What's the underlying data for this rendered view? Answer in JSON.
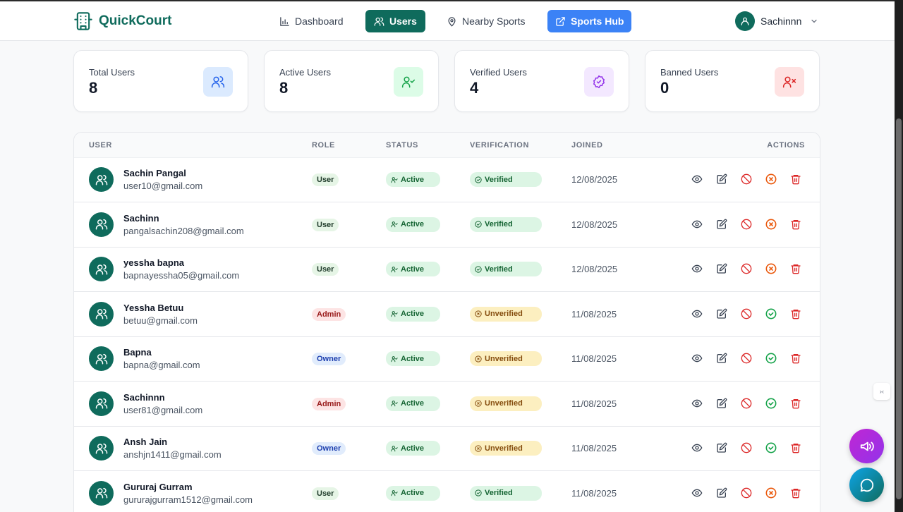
{
  "brand": {
    "name": "QuickCourt"
  },
  "nav": {
    "dashboard": "Dashboard",
    "users": "Users",
    "nearby": "Nearby Sports",
    "hub": "Sports Hub"
  },
  "profile": {
    "name": "Sachinnn"
  },
  "stats": [
    {
      "label": "Total Users",
      "value": "8",
      "icon": "users-icon",
      "bg": "#dbeafe",
      "fg": "#2563eb"
    },
    {
      "label": "Active Users",
      "value": "8",
      "icon": "user-check-icon",
      "bg": "#dcfce7",
      "fg": "#16a34a"
    },
    {
      "label": "Verified Users",
      "value": "4",
      "icon": "badge-check-icon",
      "bg": "#f3e8ff",
      "fg": "#9333ea"
    },
    {
      "label": "Banned Users",
      "value": "0",
      "icon": "user-x-icon",
      "bg": "#fee2e2",
      "fg": "#dc2626"
    }
  ],
  "table": {
    "headers": {
      "user": "USER",
      "role": "ROLE",
      "status": "STATUS",
      "verification": "VERIFICATION",
      "joined": "JOINED",
      "actions": "ACTIONS"
    },
    "rows": [
      {
        "name": "Sachin Pangal",
        "email": "user10@gmail.com",
        "role": "User",
        "status": "Active",
        "verification": "Verified",
        "joined": "12/08/2025"
      },
      {
        "name": "Sachinn",
        "email": "pangalsachin208@gmail.com",
        "role": "User",
        "status": "Active",
        "verification": "Verified",
        "joined": "12/08/2025"
      },
      {
        "name": "yessha bapna",
        "email": "bapnayessha05@gmail.com",
        "role": "User",
        "status": "Active",
        "verification": "Verified",
        "joined": "12/08/2025"
      },
      {
        "name": "Yessha Betuu",
        "email": "betuu@gmail.com",
        "role": "Admin",
        "status": "Active",
        "verification": "Unverified",
        "joined": "11/08/2025"
      },
      {
        "name": "Bapna",
        "email": "bapna@gmail.com",
        "role": "Owner",
        "status": "Active",
        "verification": "Unverified",
        "joined": "11/08/2025"
      },
      {
        "name": "Sachinnn",
        "email": "user81@gmail.com",
        "role": "Admin",
        "status": "Active",
        "verification": "Unverified",
        "joined": "11/08/2025"
      },
      {
        "name": "Ansh Jain",
        "email": "anshjn1411@gmail.com",
        "role": "Owner",
        "status": "Active",
        "verification": "Unverified",
        "joined": "11/08/2025"
      },
      {
        "name": "Gururaj Gurram",
        "email": "gururajgurram1512@gmail.com",
        "role": "User",
        "status": "Active",
        "verification": "Verified",
        "joined": "11/08/2025"
      }
    ]
  },
  "colors": {
    "brand": "#0f6b5c",
    "hub": "#3b82f6"
  }
}
